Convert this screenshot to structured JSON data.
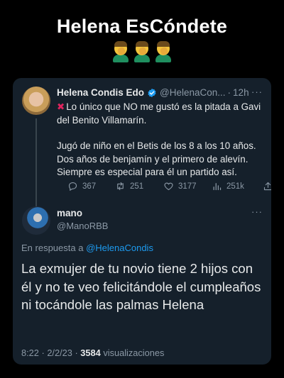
{
  "meme": {
    "title": "Helena EsCóndete",
    "emoji": [
      "facepalm-icon",
      "facepalm-icon",
      "facepalm-icon"
    ]
  },
  "quoted_tweet": {
    "author_name": "Helena Condis Edo",
    "verified": true,
    "handle": "@HelenaCon...",
    "separator": "·",
    "time": "12h",
    "more": "···",
    "text_line1": "Lo único que NO me gustó es la pitada a Gavi del Benito Villamarín.",
    "text_line2": "Jugó de niño en el Betis de los 8 a los 10 años. Dos años de benjamín y el primero de alevín. Siempre es especial para él un partido así.",
    "actions": {
      "replies": "367",
      "retweets": "251",
      "likes": "3177",
      "views": "251k"
    }
  },
  "reply_tweet": {
    "author_name": "mano",
    "handle": "@ManoRBB",
    "more": "···",
    "reply_prefix": "En respuesta a",
    "reply_mention": "@HelenaCondis",
    "text": "La exmujer de tu novio tiene 2 hijos con él y no te veo felicitándole el cumpleaños ni tocándole las palmas Helena",
    "time": "8:22",
    "separator": "·",
    "date": "2/2/23",
    "separator2": "·",
    "view_count": "3584",
    "view_label": "visualizaciones"
  },
  "colors": {
    "background": "#000000",
    "card": "#15202b",
    "text": "#e7e9ea",
    "muted": "#8b98a5",
    "accent": "#1d9bf0",
    "red_x": "#e0245e"
  }
}
